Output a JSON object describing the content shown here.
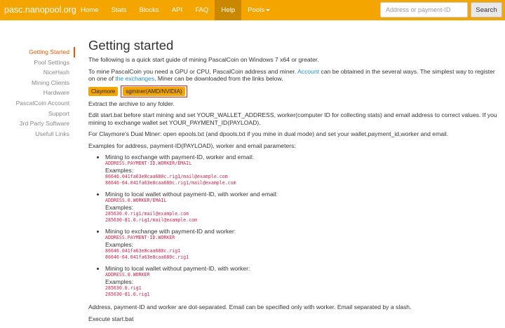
{
  "brand": "pasc.nanopool.org",
  "nav": {
    "items": [
      "Home",
      "Stats",
      "Blocks",
      "API",
      "FAQ",
      "Help",
      "Pools"
    ],
    "active": 5
  },
  "search": {
    "placeholder": "Address or payment-ID",
    "button": "Search"
  },
  "sidebar": {
    "items": [
      "Getting Started",
      "Pool Settings",
      "NiceHash",
      "Mining Clients",
      "Hardware",
      "PascalCoin Account",
      "Support",
      "3rd Party Software",
      "Usefull Links"
    ],
    "active": 0
  },
  "main": {
    "title": "Getting started",
    "intro": "The following is a quick start guide of mining PascalCoin on Windows 7 x64 or greater.",
    "para2_a": "To mine PascalCoin you need a GPU or CPU, PascalCoin address and miner.",
    "para2_link1": "Account",
    "para2_b": "can be obtained in the several ways. The simplest way to register on one of",
    "para2_link2": "the exchanges",
    "para2_c": ". Miner can be downloaded from the links below.",
    "buttons": [
      "Claymore",
      "sgminer(AMD/NVIDIA)"
    ],
    "extract": "Extract the archive to any folder.",
    "edit": "Edit start.bat before start mining and set YOUR_WALLET_ADDRESS, worker(computer ID for collecting stats) and email address to correct values. If you mining to exchange wallet set YOUR_PAYMENT_ID(PAYLOAD).",
    "dual": "For Claymore's Dual Miner: open epools.txt (and dpools.txt if you mine in dual mode) and set your wallet,payment_id,worker and email.",
    "examples_intro": "Examples for address, payment-ID(PAYLOAD), worker and email parameters:",
    "examples_label": "Examples:",
    "examples": [
      {
        "title": "Mining to exchange with payment-ID, worker and email:",
        "format": "ADDRESS.PAYMENT-ID.WORKER/EMAIL",
        "lines": [
          "86646.041fa63e8caa680c.rig1/mail@example.com",
          "86646-64.041fa63e8caa680c.rig1/mail@example.com"
        ]
      },
      {
        "title": "Mining to local wallet without payment-ID, with worker and email:",
        "format": "ADDRESS.0.WORKER/EMAIL",
        "lines": [
          "285630.0.rig1/mail@example.com",
          "285630-81.0.rig1/mail@example.com"
        ]
      },
      {
        "title": "Mining to exchange with payment-ID and worker:",
        "format": "ADDRESS.PAYMENT-ID.WORKER",
        "lines": [
          "86646.041fa63e8caa680c.rig1",
          "86646-64.041fa63e8caa680c.rig1"
        ]
      },
      {
        "title": "Mining to local wallet without payment-ID, with worker:",
        "format": "ADDRESS.0.WORKER",
        "lines": [
          "285630.0.rig1",
          "285630-81.0.rig1"
        ]
      }
    ],
    "dot_separated": "Address, payment-ID and worker are dot-separated. Email can be specified only with worker. Email separated by a slash.",
    "execute": "Execute start.bat"
  }
}
